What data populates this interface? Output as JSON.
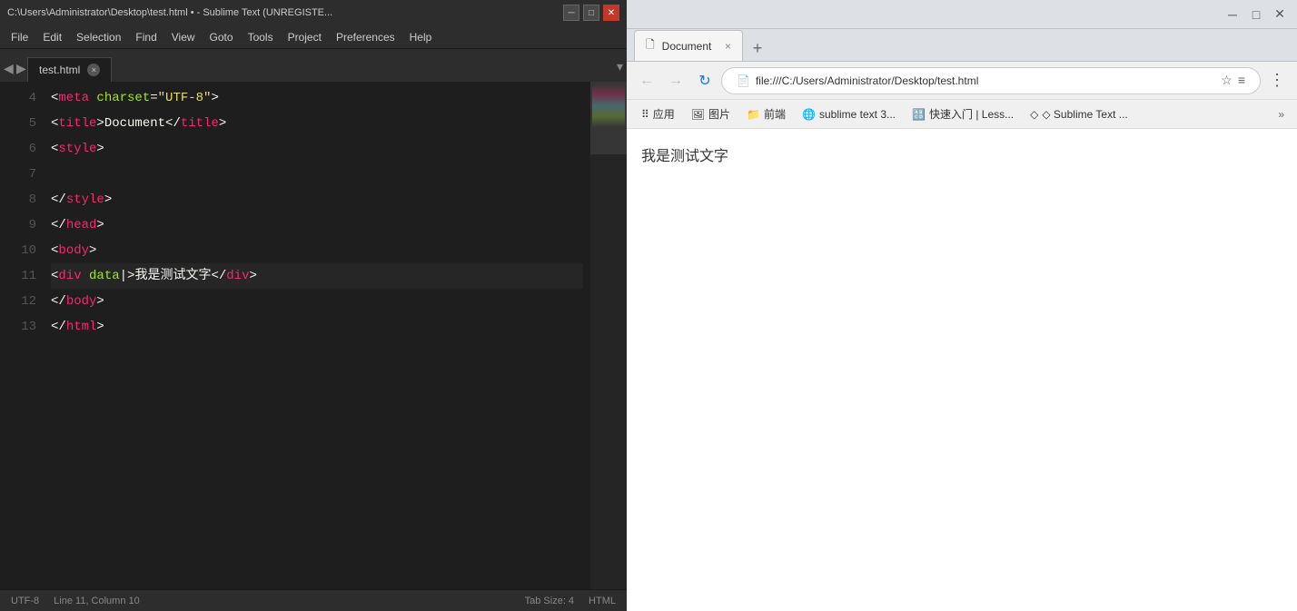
{
  "editor": {
    "title_bar": {
      "path": "C:\\Users\\Administrator\\Desktop\\test.html • - Sublime Text (UNREGISTE...",
      "min_label": "─",
      "max_label": "□",
      "close_label": "✕"
    },
    "menu": {
      "items": [
        "File",
        "Edit",
        "Selection",
        "Find",
        "View",
        "Goto",
        "Tools",
        "Project",
        "Preferences",
        "Help"
      ]
    },
    "tab": {
      "name": "test.html",
      "close_label": "×"
    },
    "lines": [
      {
        "num": "4",
        "html": "<span class='punct'>&lt;</span><span class='tag'>meta</span> <span class='attr'>charset</span><span class='punct'>=</span><span class='val'>\"UTF-8\"</span><span class='punct'>&gt;</span>"
      },
      {
        "num": "5",
        "html": "<span class='punct'>&lt;</span><span class='tag'>title</span><span class='punct'>&gt;</span><span class='text'>Document</span><span class='punct'>&lt;/</span><span class='tag'>title</span><span class='punct'>&gt;</span>"
      },
      {
        "num": "6",
        "html": "<span class='punct'>&lt;</span><span class='tag'>style</span><span class='punct'>&gt;</span>"
      },
      {
        "num": "7",
        "html": ""
      },
      {
        "num": "8",
        "html": "<span class='punct'>&lt;/</span><span class='tag'>style</span><span class='punct'>&gt;</span>"
      },
      {
        "num": "9",
        "html": "<span class='punct'>&lt;/</span><span class='tag'>head</span><span class='punct'>&gt;</span>"
      },
      {
        "num": "10",
        "html": "<span class='punct'>&lt;</span><span class='tag'>body</span><span class='punct'>&gt;</span>"
      },
      {
        "num": "11",
        "html": "<span class='punct'>&lt;</span><span class='tag'>div</span> <span class='attr'>data</span><span class='punct'>&gt;</span><span class='text'>我是测试文字</span><span class='punct'>&lt;/</span><span class='tag'>div</span><span class='punct'>&gt;</span>"
      },
      {
        "num": "12",
        "html": "<span class='punct'>&lt;/</span><span class='tag'>body</span><span class='punct'>&gt;</span>"
      },
      {
        "num": "13",
        "html": "<span class='punct'>&lt;/</span><span class='tag'>html</span><span class='punct'>&gt;</span>"
      }
    ],
    "status": {
      "encoding": "UTF-8",
      "position": "Line 11, Column 10",
      "tab_size": "Tab Size: 4",
      "syntax": "HTML"
    }
  },
  "browser": {
    "title_bar": {
      "min_label": "─",
      "max_label": "□",
      "close_label": "✕"
    },
    "tab": {
      "title": "Document",
      "close_label": "×"
    },
    "address": {
      "url": "file:///C:/Users/Administrator/Desktop/test.html",
      "back_label": "←",
      "forward_label": "→",
      "refresh_label": "↻"
    },
    "bookmarks": [
      {
        "label": "应用",
        "icon": "⠿"
      },
      {
        "label": "图片",
        "icon": "🖼"
      },
      {
        "label": "前端",
        "icon": "📁"
      },
      {
        "label": "sublime text 3...",
        "icon": "🌐"
      },
      {
        "label": "快速入门 | Less...",
        "icon": "🔠"
      },
      {
        "label": "◇ Sublime Text ...",
        "icon": ""
      }
    ],
    "bookmark_more": "»",
    "content": {
      "text": "我是测试文字"
    }
  }
}
